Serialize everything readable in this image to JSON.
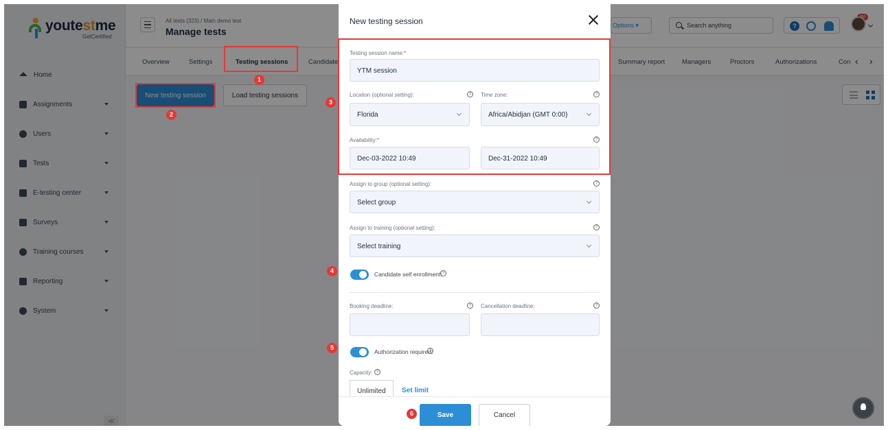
{
  "logo": {
    "text_main": "youte",
    "text_accent": "st",
    "text_end": "me",
    "sub": "GetCertified"
  },
  "sidebar": {
    "items": [
      {
        "label": "Home",
        "icon": "home-icon"
      },
      {
        "label": "Assignments",
        "icon": "assignments-icon"
      },
      {
        "label": "Users",
        "icon": "users-icon"
      },
      {
        "label": "Tests",
        "icon": "tests-icon"
      },
      {
        "label": "E-testing center",
        "icon": "calendar-icon"
      },
      {
        "label": "Surveys",
        "icon": "surveys-icon"
      },
      {
        "label": "Training courses",
        "icon": "trophy-icon"
      },
      {
        "label": "Reporting",
        "icon": "reporting-icon"
      },
      {
        "label": "System",
        "icon": "gear-icon"
      }
    ],
    "collapse_label": "≪"
  },
  "header": {
    "breadcrumb": "All tests (323)  /  Main demo test",
    "title": "Manage tests",
    "options_label": "Options ▾",
    "search_placeholder": "Search anything",
    "badge_count": "260"
  },
  "tabs": {
    "items": [
      "Overview",
      "Settings",
      "Testing sessions",
      "Candidates",
      "Summary report",
      "Managers",
      "Proctors",
      "Authorizations",
      "Con"
    ],
    "prev": "‹",
    "next": "›"
  },
  "main": {
    "new_session_label": "New testing session",
    "load_sessions_label": "Load testing sessions"
  },
  "markers": [
    "1",
    "2",
    "3",
    "4",
    "5",
    "6"
  ],
  "modal": {
    "title": "New testing session",
    "session_name_label": "Testing session name:*",
    "session_name_value": "YTM session",
    "location_label": "Location (optional setting):",
    "location_value": "Florida",
    "timezone_label": "Time zone:",
    "timezone_value": "Africa/Abidjan (GMT 0:00)",
    "availability_label": "Availability:*",
    "availability_start": "Dec-03-2022 10:49",
    "availability_end": "Dec-31-2022 10:49",
    "group_label": "Assign to group (optional setting):",
    "group_placeholder": "Select group",
    "training_label": "Assign to training (optional setting):",
    "training_placeholder": "Select training",
    "self_enrollment_label": "Candidate self enrollment:",
    "booking_label": "Booking deadline:",
    "cancellation_label": "Cancellation deadline:",
    "authorization_label": "Authorization required:",
    "capacity_label": "Capacity:",
    "capacity_unlimited": "Unlimited",
    "capacity_set_limit": "Set limit",
    "save_label": "Save",
    "cancel_label": "Cancel"
  },
  "colors": {
    "accent": "#2c8fd6",
    "marker": "#e53935"
  }
}
